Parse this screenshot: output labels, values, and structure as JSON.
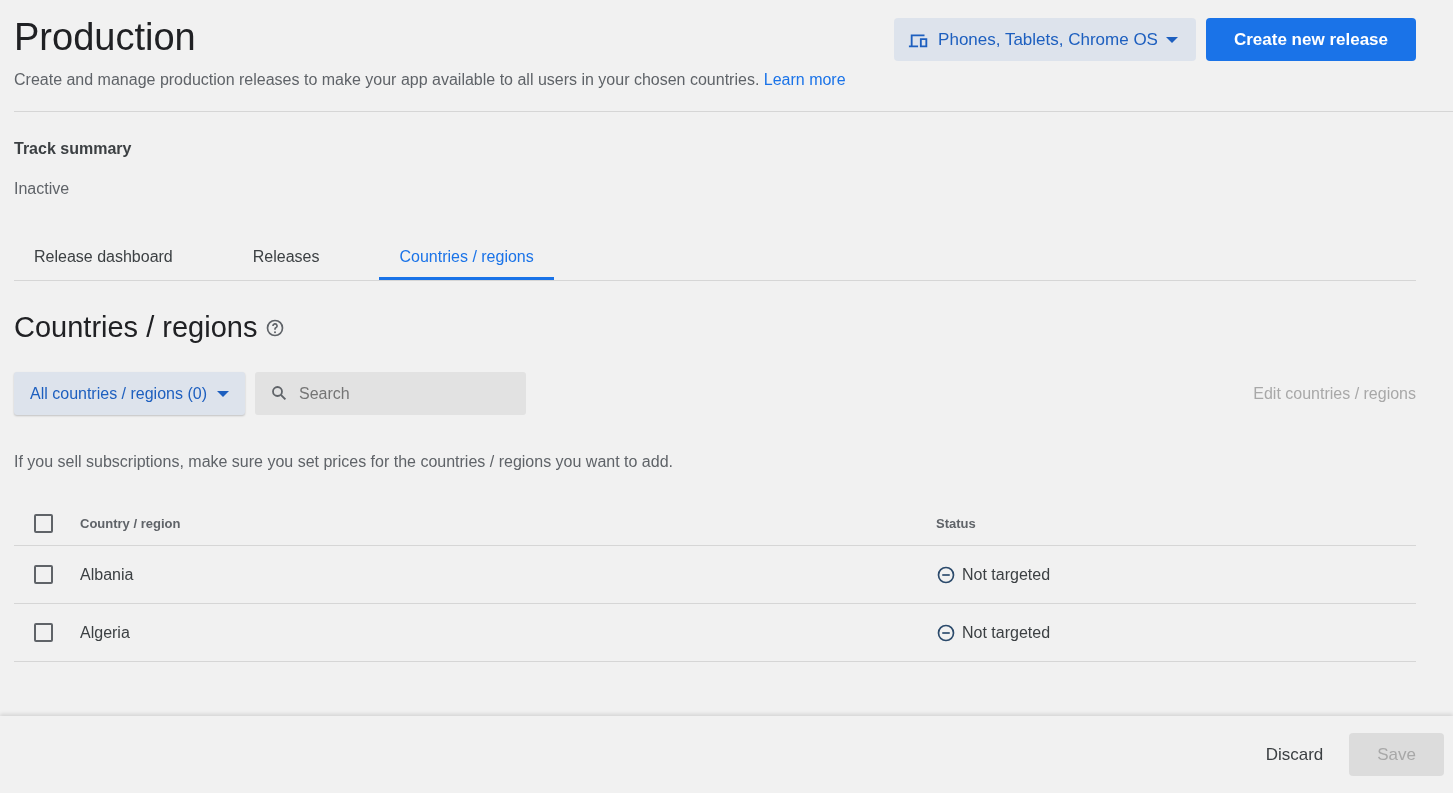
{
  "header": {
    "title": "Production",
    "device_selector": "Phones, Tablets, Chrome OS",
    "primary_button": "Create new release",
    "description": "Create and manage production releases to make your app available to all users in your chosen countries.",
    "learn_more": "Learn more"
  },
  "track_summary": {
    "label": "Track summary",
    "status": "Inactive"
  },
  "tabs": [
    {
      "label": "Release dashboard",
      "selected": false
    },
    {
      "label": "Releases",
      "selected": false
    },
    {
      "label": "Countries / regions",
      "selected": true
    }
  ],
  "section": {
    "title": "Countries / regions",
    "filter": "All countries / regions (0)",
    "search": {
      "placeholder": "Search"
    },
    "edit_link": "Edit countries / regions",
    "disabled_edit": true,
    "note": "If you sell subscriptions, make sure you set prices for the countries / regions you want to add."
  },
  "table": {
    "columns": [
      "Country / region",
      "Status"
    ],
    "header_checked": false,
    "rows": [
      {
        "country": "Albania",
        "status": "Not targeted",
        "checked": false
      },
      {
        "country": "Algeria",
        "status": "Not targeted",
        "checked": false
      }
    ]
  },
  "footer": {
    "discard": "Discard",
    "save": "Save",
    "save_disabled": true
  }
}
